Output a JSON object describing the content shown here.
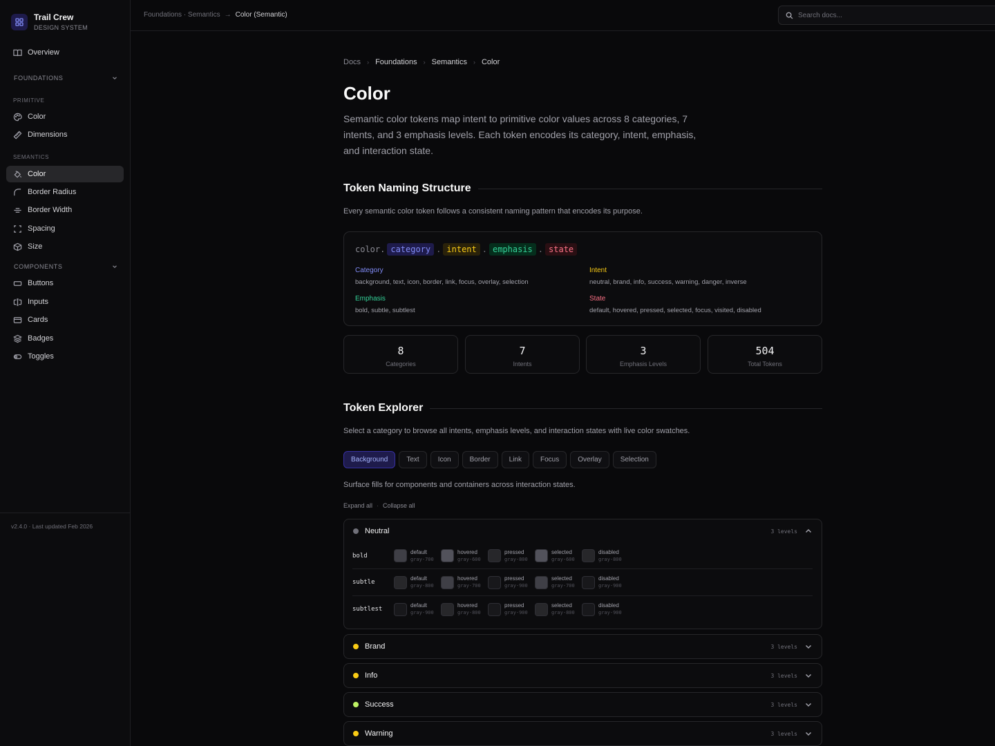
{
  "brand": {
    "name": "Trail Crew",
    "subtitle": "DESIGN SYSTEM"
  },
  "sidebar": {
    "overview": "Overview",
    "foundations_label": "FOUNDATIONS",
    "primitive_label": "PRIMITIVE",
    "primitive_items": [
      "Color",
      "Dimensions"
    ],
    "semantics_label": "SEMANTICS",
    "semantics_items": [
      "Color",
      "Border Radius",
      "Border Width",
      "Spacing",
      "Size"
    ],
    "components_label": "COMPONENTS",
    "components_items": [
      "Buttons",
      "Inputs",
      "Cards",
      "Badges",
      "Toggles"
    ],
    "footer": "v2.4.0 · Last updated Feb 2026"
  },
  "topbar": {
    "crumb1": "Foundations · Semantics",
    "crumb2": "Color (Semantic)",
    "search_placeholder": "Search docs..."
  },
  "breadcrumb": [
    "Docs",
    "Foundations",
    "Semantics",
    "Color"
  ],
  "page": {
    "title": "Color",
    "intro": "Semantic color tokens map intent to primitive color values across 8 categories, 7 intents, and 3 emphasis levels. Each token encodes its category, intent, emphasis, and interaction state."
  },
  "naming": {
    "heading": "Token Naming Structure",
    "desc": "Every semantic color token follows a consistent naming pattern that encodes its purpose.",
    "prefix": "color.",
    "segments": [
      "category",
      "intent",
      "emphasis",
      "state"
    ],
    "sep": ".",
    "defs": {
      "category": {
        "label": "Category",
        "values": "background, text, icon, border, link, focus, overlay, selection"
      },
      "intent": {
        "label": "Intent",
        "values": "neutral, brand, info, success, warning, danger, inverse"
      },
      "emphasis": {
        "label": "Emphasis",
        "values": "bold, subtle, subtlest"
      },
      "state": {
        "label": "State",
        "values": "default, hovered, pressed, selected, focus, visited, disabled"
      }
    }
  },
  "stats": [
    {
      "value": "8",
      "label": "Categories"
    },
    {
      "value": "7",
      "label": "Intents"
    },
    {
      "value": "3",
      "label": "Emphasis Levels"
    },
    {
      "value": "504",
      "label": "Total Tokens"
    }
  ],
  "explorer": {
    "heading": "Token Explorer",
    "desc": "Select a category to browse all intents, emphasis levels, and interaction states with live color swatches.",
    "tabs": [
      "Background",
      "Text",
      "Icon",
      "Border",
      "Link",
      "Focus",
      "Overlay",
      "Selection"
    ],
    "active_tab": "Background",
    "category_desc": "Surface fills for components and containers across interaction states.",
    "expand_all": "Expand all",
    "collapse_all": "Collapse all"
  },
  "intents": [
    {
      "name": "Neutral",
      "levels": "3 levels",
      "color": "#71717a",
      "expanded": true,
      "rows": [
        {
          "level": "bold",
          "swatches": [
            {
              "state": "default",
              "token": "gray-700",
              "hex": "#3f3f46"
            },
            {
              "state": "hovered",
              "token": "gray-600",
              "hex": "#52525b"
            },
            {
              "state": "pressed",
              "token": "gray-800",
              "hex": "#27272a"
            },
            {
              "state": "selected",
              "token": "gray-600",
              "hex": "#52525b"
            },
            {
              "state": "disabled",
              "token": "gray-800",
              "hex": "#27272a"
            }
          ]
        },
        {
          "level": "subtle",
          "swatches": [
            {
              "state": "default",
              "token": "gray-800",
              "hex": "#27272a"
            },
            {
              "state": "hovered",
              "token": "gray-700",
              "hex": "#3f3f46"
            },
            {
              "state": "pressed",
              "token": "gray-900",
              "hex": "#18181b"
            },
            {
              "state": "selected",
              "token": "gray-700",
              "hex": "#3f3f46"
            },
            {
              "state": "disabled",
              "token": "gray-900",
              "hex": "#18181b"
            }
          ]
        },
        {
          "level": "subtlest",
          "swatches": [
            {
              "state": "default",
              "token": "gray-900",
              "hex": "#18181b"
            },
            {
              "state": "hovered",
              "token": "gray-800",
              "hex": "#27272a"
            },
            {
              "state": "pressed",
              "token": "gray-900",
              "hex": "#18181b"
            },
            {
              "state": "selected",
              "token": "gray-800",
              "hex": "#27272a"
            },
            {
              "state": "disabled",
              "token": "gray-900",
              "hex": "#18181b"
            }
          ]
        }
      ]
    },
    {
      "name": "Brand",
      "levels": "3 levels",
      "color": "#facc15",
      "expanded": false
    },
    {
      "name": "Info",
      "levels": "3 levels",
      "color": "#facc15",
      "expanded": false
    },
    {
      "name": "Success",
      "levels": "3 levels",
      "color": "#bef264",
      "expanded": false
    },
    {
      "name": "Warning",
      "levels": "3 levels",
      "color": "#facc15",
      "expanded": false
    }
  ]
}
